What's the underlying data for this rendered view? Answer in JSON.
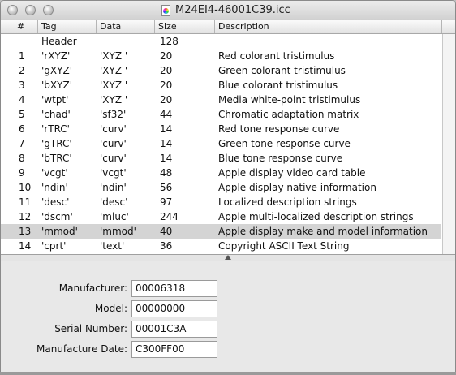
{
  "window": {
    "title": "M24EI4-46001C39.icc"
  },
  "columns": [
    "#",
    "Tag",
    "Data",
    "Size",
    "Description"
  ],
  "header_row": {
    "tag": "Header",
    "size": "128"
  },
  "rows": [
    {
      "num": "1",
      "tag": "'rXYZ'",
      "data": "'XYZ '",
      "size": "20",
      "desc": "Red colorant tristimulus"
    },
    {
      "num": "2",
      "tag": "'gXYZ'",
      "data": "'XYZ '",
      "size": "20",
      "desc": "Green colorant tristimulus"
    },
    {
      "num": "3",
      "tag": "'bXYZ'",
      "data": "'XYZ '",
      "size": "20",
      "desc": "Blue colorant tristimulus"
    },
    {
      "num": "4",
      "tag": "'wtpt'",
      "data": "'XYZ '",
      "size": "20",
      "desc": "Media white-point tristimulus"
    },
    {
      "num": "5",
      "tag": "'chad'",
      "data": "'sf32'",
      "size": "44",
      "desc": "Chromatic adaptation matrix"
    },
    {
      "num": "6",
      "tag": "'rTRC'",
      "data": "'curv'",
      "size": "14",
      "desc": "Red tone response curve"
    },
    {
      "num": "7",
      "tag": "'gTRC'",
      "data": "'curv'",
      "size": "14",
      "desc": "Green tone response curve"
    },
    {
      "num": "8",
      "tag": "'bTRC'",
      "data": "'curv'",
      "size": "14",
      "desc": "Blue tone response curve"
    },
    {
      "num": "9",
      "tag": "'vcgt'",
      "data": "'vcgt'",
      "size": "48",
      "desc": "Apple display video card table"
    },
    {
      "num": "10",
      "tag": "'ndin'",
      "data": "'ndin'",
      "size": "56",
      "desc": "Apple display native information"
    },
    {
      "num": "11",
      "tag": "'desc'",
      "data": "'desc'",
      "size": "97",
      "desc": "Localized description strings"
    },
    {
      "num": "12",
      "tag": "'dscm'",
      "data": "'mluc'",
      "size": "244",
      "desc": "Apple multi-localized description strings"
    },
    {
      "num": "13",
      "tag": "'mmod'",
      "data": "'mmod'",
      "size": "40",
      "desc": "Apple display make and model information",
      "selected": true
    },
    {
      "num": "14",
      "tag": "'cprt'",
      "data": "'text'",
      "size": "36",
      "desc": "Copyright ASCII Text String"
    }
  ],
  "details": [
    {
      "label": "Manufacturer:",
      "value": "00006318"
    },
    {
      "label": "Model:",
      "value": "00000000"
    },
    {
      "label": "Serial Number:",
      "value": "00001C3A"
    },
    {
      "label": "Manufacture Date:",
      "value": "C300FF00"
    }
  ],
  "colors": {
    "selection": "#d4d4d4",
    "background": "#e8e8e8"
  }
}
